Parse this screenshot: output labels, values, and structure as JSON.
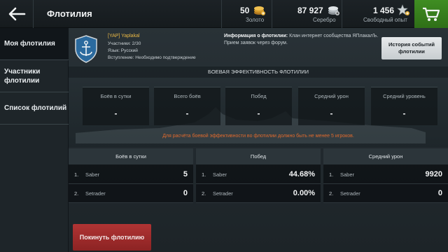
{
  "header": {
    "title": "Флотилия",
    "gold": {
      "value": "50",
      "label": "Золото"
    },
    "silver": {
      "value": "87 927",
      "label": "Серебро"
    },
    "xp": {
      "value": "1 456",
      "label": "Свободный опыт"
    }
  },
  "sidebar": {
    "items": [
      {
        "label": "Моя флотилия",
        "active": true
      },
      {
        "label": "Участники флотилии"
      },
      {
        "label": "Список флотилий"
      }
    ]
  },
  "clan": {
    "tag": "[YAP] Yaplakal",
    "members": "Участники: 2/30",
    "language": "Язык: Русский",
    "join": "Вступление: Необходимо подтверждение"
  },
  "info": {
    "heading": "Информация о флотилии:",
    "text": "Клан интернет сообщества ЯПлакалЪ. Прием заявок через форум."
  },
  "events_button": "История событий флотилии",
  "efficiency": {
    "title": "БОЕВАЯ ЭФФЕКТИВНОСТЬ ФЛОТИЛИИ",
    "cards": [
      {
        "title": "Боёв в сутки",
        "value": "-"
      },
      {
        "title": "Всего боёв",
        "value": "-"
      },
      {
        "title": "Побед",
        "value": "-"
      },
      {
        "title": "Средний урон",
        "value": "-"
      },
      {
        "title": "Средний уровень",
        "value": "-"
      }
    ],
    "warning": "Для расчёта боевой эффективности во флотилии должно быть не менее 5 игроков."
  },
  "tables": [
    {
      "header": "Боёв в сутки",
      "rows": [
        {
          "n": "1.",
          "name": "Saber",
          "value": "5"
        },
        {
          "n": "2.",
          "name": "Setrader",
          "value": "0"
        }
      ]
    },
    {
      "header": "Побед",
      "rows": [
        {
          "n": "1.",
          "name": "Saber",
          "value": "44.68%"
        },
        {
          "n": "2.",
          "name": "Setrader",
          "value": "0.00%"
        }
      ]
    },
    {
      "header": "Средний урон",
      "rows": [
        {
          "n": "1.",
          "name": "Saber",
          "value": "9920"
        },
        {
          "n": "2.",
          "name": "Setrader",
          "value": "0"
        }
      ]
    }
  ],
  "leave_button": "Покинуть флотилию",
  "colors": {
    "accent_green": "#3f8d22",
    "leave_red": "#b03434",
    "tag_gold": "#e9b845",
    "warning_orange": "#e06a2e"
  }
}
